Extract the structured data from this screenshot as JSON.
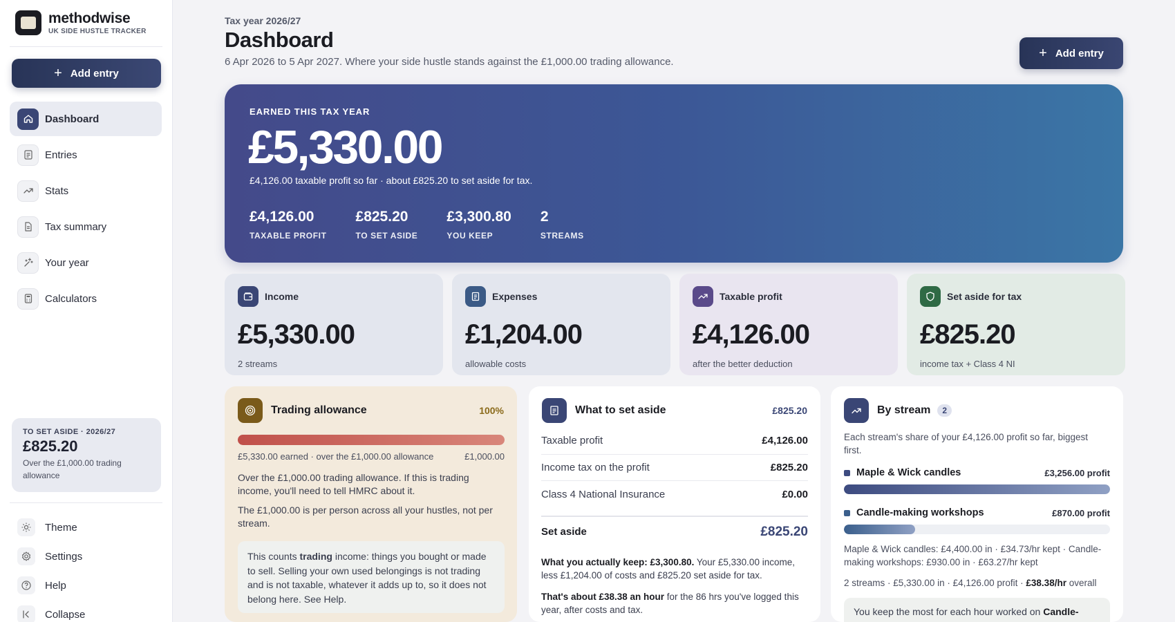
{
  "brand": {
    "name": "methodwise",
    "tagline": "UK SIDE HUSTLE TRACKER"
  },
  "sidebar": {
    "add_entry_label": "Add entry",
    "nav": [
      {
        "label": "Dashboard",
        "icon": "home-icon",
        "active": true
      },
      {
        "label": "Entries",
        "icon": "list-icon",
        "active": false
      },
      {
        "label": "Stats",
        "icon": "trend-icon",
        "active": false
      },
      {
        "label": "Tax summary",
        "icon": "document-icon",
        "active": false
      },
      {
        "label": "Your year",
        "icon": "sparkle-icon",
        "active": false
      },
      {
        "label": "Calculators",
        "icon": "calculator-icon",
        "active": false
      }
    ],
    "aside_card": {
      "label": "TO SET ASIDE · 2026/27",
      "amount": "£825.20",
      "note": "Over the £1,000.00 trading allowance"
    },
    "bottom_nav": [
      {
        "label": "Theme",
        "icon": "sun-icon"
      },
      {
        "label": "Settings",
        "icon": "gear-icon"
      },
      {
        "label": "Help",
        "icon": "help-icon"
      },
      {
        "label": "Collapse",
        "icon": "collapse-icon"
      }
    ]
  },
  "header": {
    "eyebrow": "Tax year 2026/27",
    "title": "Dashboard",
    "subtitle": "6 Apr 2026 to 5 Apr 2027. Where your side hustle stands against the £1,000.00 trading allowance.",
    "add_entry_label": "Add entry"
  },
  "hero": {
    "label": "EARNED THIS TAX YEAR",
    "amount": "£5,330.00",
    "subtitle": "£4,126.00 taxable profit so far · about £825.20 to set aside for tax.",
    "stats": [
      {
        "value": "£4,126.00",
        "label": "TAXABLE PROFIT"
      },
      {
        "value": "£825.20",
        "label": "TO SET ASIDE"
      },
      {
        "value": "£3,300.80",
        "label": "YOU KEEP"
      },
      {
        "value": "2",
        "label": "STREAMS"
      }
    ]
  },
  "cards": [
    {
      "title": "Income",
      "value": "£5,330.00",
      "note": "2 streams",
      "icon": "wallet-icon",
      "bg": "#e3e6ee",
      "icon_bg": "#3a4675"
    },
    {
      "title": "Expenses",
      "value": "£1,204.00",
      "note": "allowable costs",
      "icon": "receipt-icon",
      "bg": "#e3e6ee",
      "icon_bg": "#3b5a86"
    },
    {
      "title": "Taxable profit",
      "value": "£4,126.00",
      "note": "after the better deduction",
      "icon": "trend-icon",
      "bg": "#e9e5f0",
      "icon_bg": "#5a4a8a"
    },
    {
      "title": "Set aside for tax",
      "value": "£825.20",
      "note": "income tax + Class 4 NI",
      "icon": "shield-icon",
      "bg": "#e2ebe5",
      "icon_bg": "#2f6a45"
    }
  ],
  "trading_allowance": {
    "title": "Trading allowance",
    "percent": "100%",
    "progress": 1.0,
    "earned_text": "£5,330.00 earned · over the £1,000.00 allowance",
    "limit_text": "£1,000.00",
    "para1": "Over the £1,000.00 trading allowance. If this is trading income, you'll need to tell HMRC about it.",
    "para2": "The £1,000.00 is per person across all your hustles, not per stream.",
    "note_before": "This counts ",
    "note_bold": "trading",
    "note_after": " income: things you bought or made to sell. Selling your own used belongings is not trading and is not taxable, whatever it adds up to, so it does not belong here. See Help."
  },
  "set_aside": {
    "title": "What to set aside",
    "total_top": "£825.20",
    "rows": [
      {
        "label": "Taxable profit",
        "value": "£4,126.00"
      },
      {
        "label": "Income tax on the profit",
        "value": "£825.20"
      },
      {
        "label": "Class 4 National Insurance",
        "value": "£0.00"
      }
    ],
    "total_label": "Set aside",
    "total_value": "£825.20",
    "keep_bold": "What you actually keep: £3,300.80.",
    "keep_text": " Your £5,330.00 income, less £1,204.00 of costs and £825.20 set aside for tax.",
    "hour_bold": "That's about £38.38 an hour",
    "hour_text": " for the 86 hrs you've logged this year, after costs and tax."
  },
  "by_stream": {
    "title": "By stream",
    "count": "2",
    "intro": "Each stream's share of your £4,126.00 profit so far, biggest first.",
    "streams": [
      {
        "name": "Maple & Wick candles",
        "profit": "£3,256.00 profit",
        "share": 1.0,
        "color": "#3d4b80"
      },
      {
        "name": "Candle-making workshops",
        "profit": "£870.00 profit",
        "share": 0.267,
        "color": "#3b5f8c"
      }
    ],
    "detail": "Maple & Wick candles: £4,400.00 in · £34.73/hr kept · Candle-making workshops: £930.00 in · £63.27/hr kept",
    "summary_text": "2 streams · £5,330.00 in · £4,126.00 profit · ",
    "summary_bold": "£38.38/hr",
    "summary_end": " overall",
    "note_text": "You keep the most for each hour worked on ",
    "note_bold": "Candle-"
  }
}
